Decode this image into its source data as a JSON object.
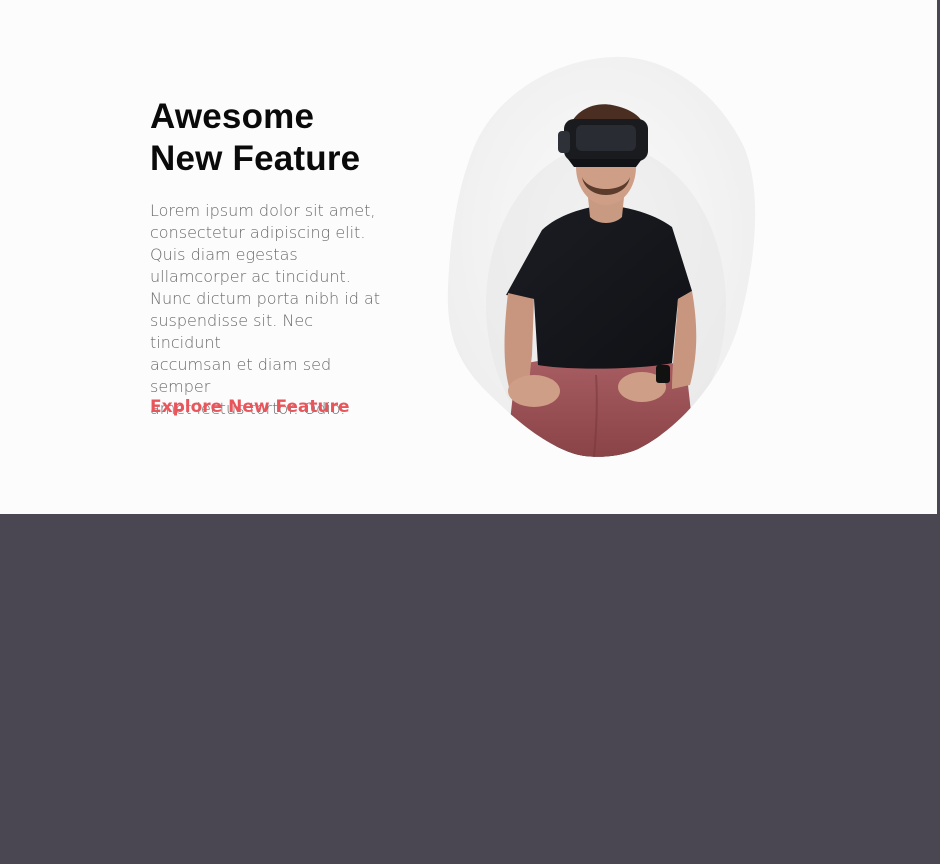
{
  "feature": {
    "title_line1": "Awesome",
    "title_line2": "New Feature",
    "body_lines": [
      "Lorem ipsum dolor sit amet,",
      "consectetur adipiscing elit.",
      "Quis diam egestas",
      "ullamcorper ac tincidunt.",
      "Nunc dictum porta nibh id at",
      "suspendisse sit. Nec tincidunt",
      "accumsan et diam sed semper",
      "amet lectus tortor. Odio."
    ],
    "cta_label": "Explore New Feature",
    "image_subject": "man-wearing-vr-headset"
  },
  "colors": {
    "hero_background": "#fcfcfc",
    "heading": "#0a0a0a",
    "body_text": "#6a6a6a",
    "accent": "#e8565c",
    "dark_section": "#4a4752"
  }
}
